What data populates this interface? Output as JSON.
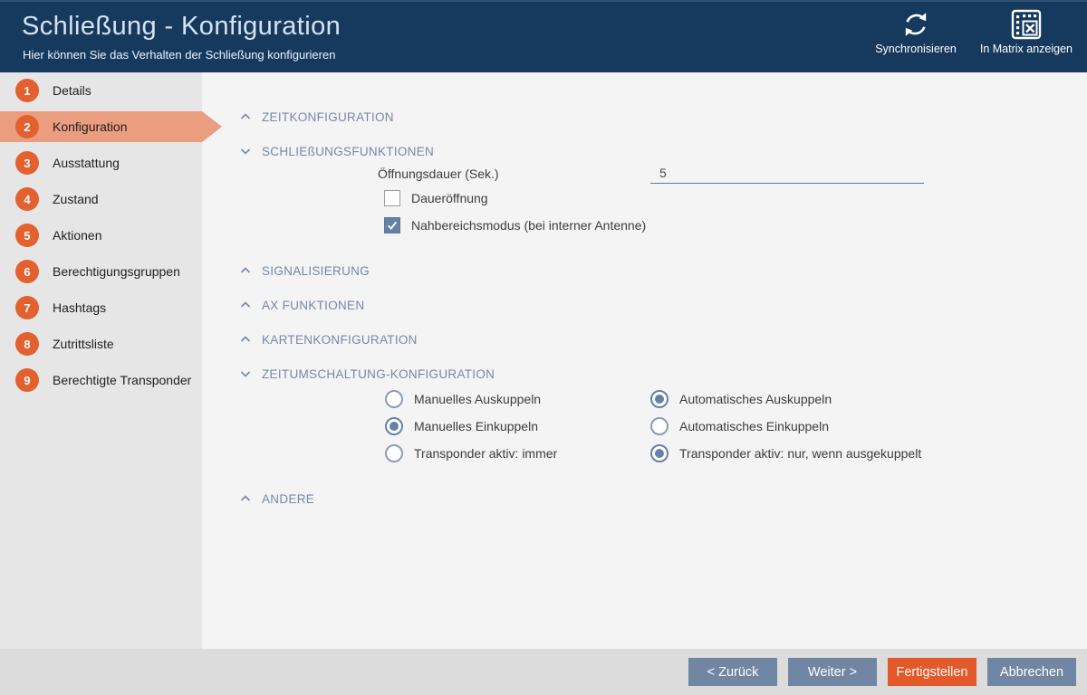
{
  "header": {
    "title": "Schließung - Konfiguration",
    "subtitle": "Hier können Sie das Verhalten der Schließung konfigurieren",
    "actions": {
      "sync_label": "Synchronisieren",
      "matrix_label": "In Matrix anzeigen"
    }
  },
  "sidebar": {
    "items": [
      {
        "number": "1",
        "label": "Details",
        "active": false
      },
      {
        "number": "2",
        "label": "Konfiguration",
        "active": true
      },
      {
        "number": "3",
        "label": "Ausstattung",
        "active": false
      },
      {
        "number": "4",
        "label": "Zustand",
        "active": false
      },
      {
        "number": "5",
        "label": "Aktionen",
        "active": false
      },
      {
        "number": "6",
        "label": "Berechtigungsgruppen",
        "active": false
      },
      {
        "number": "7",
        "label": "Hashtags",
        "active": false
      },
      {
        "number": "8",
        "label": "Zutrittsliste",
        "active": false
      },
      {
        "number": "9",
        "label": "Berechtigte Transponder",
        "active": false
      }
    ]
  },
  "main": {
    "sections": [
      {
        "label": "ZEITKONFIGURATION",
        "state": "collapsed"
      },
      {
        "label": "SCHLIEßUNGSFUNKTIONEN",
        "state": "expanded"
      },
      {
        "label": "SIGNALISIERUNG",
        "state": "collapsed"
      },
      {
        "label": "AX FUNKTIONEN",
        "state": "collapsed"
      },
      {
        "label": "KARTENKONFIGURATION",
        "state": "collapsed"
      },
      {
        "label": "ZEITUMSCHALTUNG-KONFIGURATION",
        "state": "expanded"
      },
      {
        "label": "ANDERE",
        "state": "collapsed"
      }
    ],
    "schliessungsfunktionen": {
      "oeffnungsdauer_label": "Öffnungsdauer (Sek.)",
      "oeffnungsdauer_value": "5",
      "checkboxes": [
        {
          "label": "Daueröffnung",
          "checked": false
        },
        {
          "label": "Nahbereichsmodus (bei interner Antenne)",
          "checked": true
        }
      ]
    },
    "zeitumschaltung": {
      "rows": [
        {
          "left": {
            "label": "Manuelles Auskuppeln",
            "selected": false
          },
          "right": {
            "label": "Automatisches Auskuppeln",
            "selected": true
          }
        },
        {
          "left": {
            "label": "Manuelles Einkuppeln",
            "selected": true
          },
          "right": {
            "label": "Automatisches Einkuppeln",
            "selected": false
          }
        },
        {
          "left": {
            "label": "Transponder aktiv: immer",
            "selected": false
          },
          "right": {
            "label": "Transponder aktiv: nur, wenn ausgekuppelt",
            "selected": true
          }
        }
      ]
    }
  },
  "footer": {
    "buttons": [
      {
        "label": "< Zurück",
        "style": "blue"
      },
      {
        "label": "Weiter >",
        "style": "blue"
      },
      {
        "label": "Fertigstellen",
        "style": "orange"
      },
      {
        "label": "Abbrechen",
        "style": "blue"
      }
    ]
  },
  "colors": {
    "header_bg": "#16395e",
    "accent_orange": "#e2612e",
    "active_step_bg": "#ea9d7f",
    "control_blue": "#6781a6",
    "section_text": "#7488a8",
    "button_blue": "#7186a2",
    "button_orange": "#e4592a"
  }
}
